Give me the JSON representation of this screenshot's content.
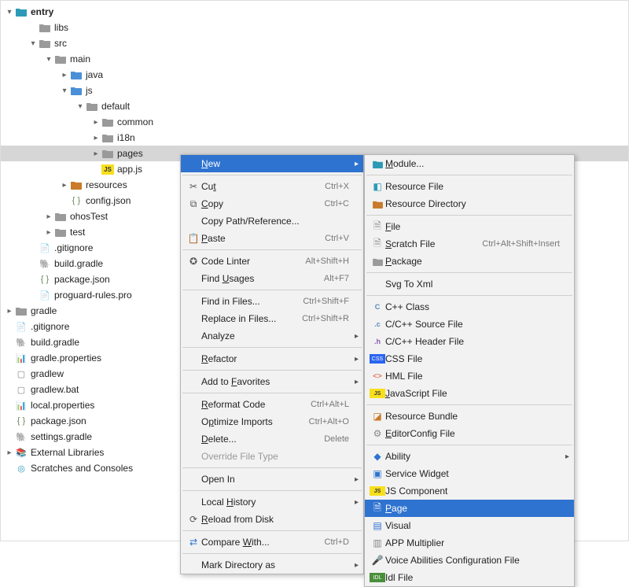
{
  "tree": {
    "entry": "entry",
    "libs": "libs",
    "src": "src",
    "main": "main",
    "java": "java",
    "js": "js",
    "default": "default",
    "common": "common",
    "i18n": "i18n",
    "pages": "pages",
    "appjs": "app.js",
    "resources": "resources",
    "configjson": "config.json",
    "ohosTest": "ohosTest",
    "test": "test",
    "gitignore": ".gitignore",
    "buildgradle": "build.gradle",
    "packagejson": "package.json",
    "proguard": "proguard-rules.pro",
    "gradle": "gradle",
    "gitignore2": ".gitignore",
    "buildgradle2": "build.gradle",
    "gradleprops": "gradle.properties",
    "gradlew": "gradlew",
    "gradlewbat": "gradlew.bat",
    "localprops": "local.properties",
    "packagejson2": "package.json",
    "settingsgradle": "settings.gradle",
    "extlibs": "External Libraries",
    "scratches": "Scratches and Consoles"
  },
  "ctx": {
    "new": "New",
    "cut": "Cut",
    "cut_sc": "Ctrl+X",
    "copy": "Copy",
    "copy_sc": "Ctrl+C",
    "copypath": "Copy Path/Reference...",
    "paste": "Paste",
    "paste_sc": "Ctrl+V",
    "codelinter": "Code Linter",
    "codelinter_sc": "Alt+Shift+H",
    "findusages": "Find Usages",
    "findusages_sc": "Alt+F7",
    "findinfiles": "Find in Files...",
    "findinfiles_sc": "Ctrl+Shift+F",
    "replaceinfiles": "Replace in Files...",
    "replaceinfiles_sc": "Ctrl+Shift+R",
    "analyze": "Analyze",
    "refactor": "Refactor",
    "addfav": "Add to Favorites",
    "reformat": "Reformat Code",
    "reformat_sc": "Ctrl+Alt+L",
    "optimize": "Optimize Imports",
    "optimize_sc": "Ctrl+Alt+O",
    "delete": "Delete...",
    "delete_sc": "Delete",
    "override": "Override File Type",
    "openin": "Open In",
    "localhist": "Local History",
    "reload": "Reload from Disk",
    "compare": "Compare With...",
    "compare_sc": "Ctrl+D",
    "markdir": "Mark Directory as"
  },
  "ctx_underline": {
    "new": 0,
    "cut": 2,
    "copy": 0,
    "paste": 0,
    "findusages": 5,
    "refactor": 0,
    "addfav": 7,
    "reformat": 0,
    "optimize": 1,
    "delete": 0,
    "localhist": 6,
    "reload": 0,
    "compare": 8
  },
  "sub": {
    "module": "Module...",
    "resfile": "Resource File",
    "resdir": "Resource Directory",
    "file": "File",
    "scratch": "Scratch File",
    "scratch_sc": "Ctrl+Alt+Shift+Insert",
    "package": "Package",
    "svg": "Svg To Xml",
    "cppclass": "C++ Class",
    "csource": "C/C++ Source File",
    "cheader": "C/C++ Header File",
    "css": "CSS File",
    "hml": "HML File",
    "jsfile": "JavaScript File",
    "resbundle": "Resource Bundle",
    "editorcfg": "EditorConfig File",
    "ability": "Ability",
    "svcwidget": "Service Widget",
    "jscomp": "JS Component",
    "page": "Page",
    "visual": "Visual",
    "appmult": "APP Multiplier",
    "voice": "Voice Abilities Configuration File",
    "idl": "Idl File"
  },
  "sub_underline": {
    "module": 0,
    "file": 0,
    "scratch": 0,
    "package": 0,
    "jsfile": 0,
    "editorcfg": 0,
    "page": 0
  }
}
